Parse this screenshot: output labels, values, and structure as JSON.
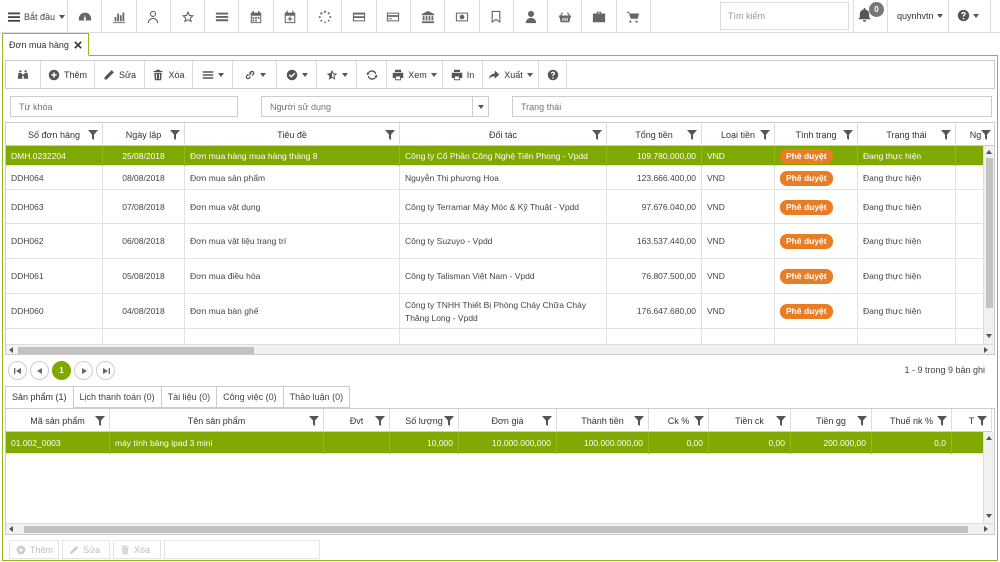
{
  "topbar": {
    "start_label": "Bắt đầu",
    "nav_icons": [
      "dashboard-icon",
      "bar-chart-icon",
      "user-icon",
      "star-icon",
      "list-icon",
      "calendar-icon",
      "calendar-plus-icon",
      "spinner-icon",
      "card-icon",
      "credit-card-icon",
      "bank-icon",
      "money-icon",
      "bookmark-icon",
      "person-icon",
      "basket-icon",
      "briefcase-icon",
      "cart-icon"
    ],
    "search_placeholder": "Tìm kiếm",
    "notification_count": "0",
    "username": "quynhvtn"
  },
  "doc_tab": {
    "label": "Đơn mua hàng"
  },
  "toolbar": {
    "add_label": "Thêm",
    "edit_label": "Sửa",
    "delete_label": "Xóa",
    "view_label": "Xem",
    "print_label": "In",
    "export_label": "Xuất"
  },
  "filters": {
    "keyword_placeholder": "Từ khóa",
    "user_placeholder": "Người sử dụng",
    "status_placeholder": "Trạng thái"
  },
  "orders": {
    "columns": [
      "Số đơn hàng",
      "Ngày lập",
      "Tiêu đề",
      "Đối tác",
      "Tổng tiền",
      "Loại tiền",
      "Tình trạng",
      "Trạng thái",
      "Ng"
    ],
    "rows": [
      {
        "code": "DMH.0232204",
        "date": "25/08/2018",
        "title": "Đơn mua hàng mua hàng tháng 8",
        "partner": "Công ty Cổ Phần Công Nghệ Tiên Phong - Vpdd",
        "total": "109.780.000,00",
        "currency": "VND",
        "approval": "Phê duyệt",
        "status": "Đang thực hiện"
      },
      {
        "code": "DDH064",
        "date": "08/08/2018",
        "title": "Đơn mua sản phẩm",
        "partner": "Nguyễn Thị phương Hoa",
        "total": "123.666.400,00",
        "currency": "VND",
        "approval": "Phê duyệt",
        "status": "Đang thực hiện"
      },
      {
        "code": "DDH063",
        "date": "07/08/2018",
        "title": "Đơn mua vật dụng",
        "partner": "Công ty Terramar Máy Móc & Kỹ Thuật - Vpdd",
        "total": "97.676.040,00",
        "currency": "VND",
        "approval": "Phê duyệt",
        "status": "Đang thực hiện"
      },
      {
        "code": "DDH062",
        "date": "06/08/2018",
        "title": "Đơn mua vật liệu trang trí",
        "partner": "Công ty Suzuyo - Vpdd",
        "total": "163.537.440,00",
        "currency": "VND",
        "approval": "Phê duyệt",
        "status": "Đang thực hiện"
      },
      {
        "code": "DDH061",
        "date": "05/08/2018",
        "title": "Đơn mua điều hòa",
        "partner": "Công ty Talisman Việt Nam - Vpdd",
        "total": "76.807.500,00",
        "currency": "VND",
        "approval": "Phê duyệt",
        "status": "Đang thực hiện"
      },
      {
        "code": "DDH060",
        "date": "04/08/2018",
        "title": "Đơn mua bàn ghế",
        "partner": "Công ty TNHH Thiết Bị Phòng Cháy Chữa Cháy Thăng Long - Vpdd",
        "total": "176.647.680,00",
        "currency": "VND",
        "approval": "Phê duyệt",
        "status": "Đang thực hiện"
      }
    ]
  },
  "pager": {
    "current_page": "1",
    "info": "1 - 9 trong 9 bản ghi"
  },
  "subtabs": [
    "Sản phẩm (1)",
    "Lịch thanh toán (0)",
    "Tài liệu (0)",
    "Công việc (0)",
    "Thảo luận (0)"
  ],
  "products": {
    "columns": [
      "Mã sản phẩm",
      "Tên sản phẩm",
      "Đvt",
      "Số lượng",
      "Đơn giá",
      "Thành tiền",
      "Ck %",
      "Tiền ck",
      "Tiền gg",
      "Thuế nk %",
      "T"
    ],
    "rows": [
      {
        "code": "01.002_0003",
        "name": "máy tính bảng ipad 3 mini",
        "unit": "",
        "qty": "10,000",
        "price": "10.000.000,000",
        "amount": "100.000.000,00",
        "ck_pct": "0,00",
        "ck_amt": "0,00",
        "discount": "200.000,00",
        "tax": "0,0"
      }
    ]
  },
  "bottom_actions": {
    "add_label": "Thêm",
    "edit_label": "Sửa",
    "delete_label": "Xóa"
  },
  "colors": {
    "accent": "#7fa800",
    "approval_pill": "#e87d24"
  }
}
